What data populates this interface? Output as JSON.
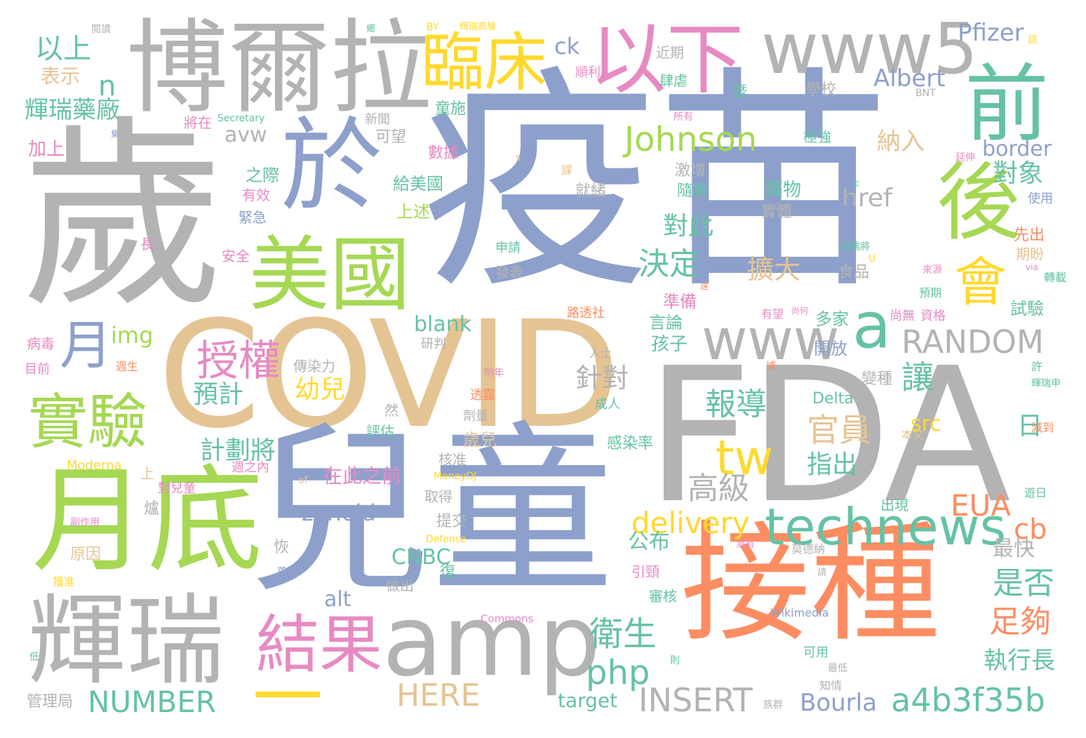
{
  "palette": {
    "grey": "#b3b3b3",
    "blue": "#8da0cb",
    "orange": "#fc8d62",
    "green": "#66c2a5",
    "pink": "#e78ac3",
    "lime": "#a6d854",
    "yellow": "#ffd92f",
    "tan": "#e5c494"
  },
  "words": [
    {
      "text": "疫苗",
      "color": "blue"
    },
    {
      "text": "歲",
      "color": "grey"
    },
    {
      "text": "FDA",
      "color": "grey"
    },
    {
      "text": "COVID",
      "color": "tan"
    },
    {
      "text": "兒童",
      "color": "blue"
    },
    {
      "text": "接種",
      "color": "orange"
    },
    {
      "text": "博爾拉",
      "color": "grey"
    },
    {
      "text": "月底",
      "color": "lime"
    },
    {
      "text": "輝瑞",
      "color": "grey"
    },
    {
      "text": "amp",
      "color": "grey"
    },
    {
      "text": "於",
      "color": "blue"
    },
    {
      "text": "美國",
      "color": "lime"
    },
    {
      "text": "以下",
      "color": "pink"
    },
    {
      "text": "www5",
      "color": "grey"
    },
    {
      "text": "前",
      "color": "green"
    },
    {
      "text": "後",
      "color": "lime"
    },
    {
      "text": "臨床",
      "color": "yellow"
    },
    {
      "text": "technews",
      "color": "green"
    },
    {
      "text": "結果",
      "color": "pink"
    },
    {
      "text": "實驗",
      "color": "lime"
    },
    {
      "text": "www",
      "color": "grey"
    },
    {
      "text": "a",
      "color": "green"
    },
    {
      "text": "會",
      "color": "yellow"
    },
    {
      "text": "月",
      "color": "blue"
    },
    {
      "text": "一",
      "color": "yellow"
    },
    {
      "text": "tw",
      "color": "yellow"
    },
    {
      "text": "Johnson",
      "color": "lime"
    },
    {
      "text": "授權",
      "color": "pink"
    },
    {
      "text": "a4b3f35b",
      "color": "green"
    },
    {
      "text": "RANDOM",
      "color": "grey"
    },
    {
      "text": "INSERT",
      "color": "grey"
    },
    {
      "text": "NUMBER",
      "color": "green"
    },
    {
      "text": "HERE",
      "color": "tan"
    },
    {
      "text": "delivery",
      "color": "yellow"
    },
    {
      "text": "php",
      "color": "green"
    },
    {
      "text": "Pfizer",
      "color": "blue"
    },
    {
      "text": "Albert",
      "color": "blue"
    },
    {
      "text": "Bourla",
      "color": "blue"
    },
    {
      "text": "以上",
      "color": "green"
    },
    {
      "text": "輝瑞藥廠",
      "color": "green"
    },
    {
      "text": "決定",
      "color": "green"
    },
    {
      "text": "報導",
      "color": "green"
    },
    {
      "text": "官員",
      "color": "tan"
    },
    {
      "text": "高級",
      "color": "grey"
    },
    {
      "text": "衛生",
      "color": "green"
    },
    {
      "text": "擴大",
      "color": "tan"
    },
    {
      "text": "是否",
      "color": "green"
    },
    {
      "text": "足夠",
      "color": "orange"
    },
    {
      "text": "EUA",
      "color": "orange"
    },
    {
      "text": "cb",
      "color": "orange"
    },
    {
      "text": "讓",
      "color": "green"
    },
    {
      "text": "對此",
      "color": "green"
    },
    {
      "text": "對象",
      "color": "green"
    },
    {
      "text": "href",
      "color": "grey"
    },
    {
      "text": "blank",
      "color": "green"
    },
    {
      "text": "zoneid",
      "color": "blue"
    },
    {
      "text": "alt",
      "color": "blue"
    },
    {
      "text": "src",
      "color": "yellow"
    },
    {
      "text": "img",
      "color": "lime"
    },
    {
      "text": "幼兒",
      "color": "yellow"
    },
    {
      "text": "針對",
      "color": "grey"
    },
    {
      "text": "預計",
      "color": "green"
    },
    {
      "text": "計劃將",
      "color": "green"
    },
    {
      "text": "指出",
      "color": "green"
    },
    {
      "text": "日",
      "color": "green"
    },
    {
      "text": "公布",
      "color": "green"
    },
    {
      "text": "最快",
      "color": "grey"
    },
    {
      "text": "執行長",
      "color": "green"
    },
    {
      "text": "CNBC",
      "color": "green"
    },
    {
      "text": "target",
      "color": "green"
    },
    {
      "text": "border",
      "color": "blue"
    },
    {
      "text": "納入",
      "color": "tan"
    },
    {
      "text": "ck",
      "color": "blue"
    },
    {
      "text": "n",
      "color": "green"
    },
    {
      "text": "avw",
      "color": "grey"
    },
    {
      "text": "表示",
      "color": "tan"
    },
    {
      "text": "加上",
      "color": "pink"
    },
    {
      "text": "在此之前",
      "color": "pink"
    },
    {
      "text": "藥物",
      "color": "green"
    },
    {
      "text": "實體",
      "color": "grey"
    },
    {
      "text": "食品",
      "color": "grey"
    },
    {
      "text": "孩子",
      "color": "green"
    },
    {
      "text": "開放",
      "color": "blue"
    },
    {
      "text": "多家",
      "color": "green"
    },
    {
      "text": "準備",
      "color": "pink"
    },
    {
      "text": "言論",
      "color": "green"
    },
    {
      "text": "試驗",
      "color": "green"
    },
    {
      "text": "歲兒",
      "color": "tan"
    },
    {
      "text": "感染率",
      "color": "green"
    },
    {
      "text": "Delta",
      "color": "green"
    },
    {
      "text": "變種",
      "color": "grey"
    },
    {
      "text": "隨著",
      "color": "green"
    },
    {
      "text": "激增",
      "color": "grey"
    },
    {
      "text": "就緒",
      "color": "grey"
    },
    {
      "text": "給美國",
      "color": "green"
    },
    {
      "text": "上述",
      "color": "lime"
    },
    {
      "text": "之際",
      "color": "green"
    },
    {
      "text": "可望",
      "color": "grey"
    },
    {
      "text": "數據",
      "color": "pink"
    },
    {
      "text": "童施",
      "color": "green"
    },
    {
      "text": "學校",
      "color": "grey"
    },
    {
      "text": "極強",
      "color": "green"
    },
    {
      "text": "先出",
      "color": "orange"
    },
    {
      "text": "期盼",
      "color": "tan"
    },
    {
      "text": "使用",
      "color": "blue"
    },
    {
      "text": "轉載",
      "color": "green"
    },
    {
      "text": "肆虐",
      "color": "green"
    },
    {
      "text": "暨",
      "color": "green"
    },
    {
      "text": "近期",
      "color": "grey"
    },
    {
      "text": "順利",
      "color": "pink"
    },
    {
      "text": "新聞",
      "color": "grey"
    },
    {
      "text": "將在",
      "color": "pink"
    },
    {
      "text": "有效",
      "color": "pink"
    },
    {
      "text": "緊急",
      "color": "blue"
    },
    {
      "text": "安全",
      "color": "pink"
    },
    {
      "text": "病毒",
      "color": "pink"
    },
    {
      "text": "目前",
      "color": "pink"
    },
    {
      "text": "長",
      "color": "pink"
    },
    {
      "text": "原因",
      "color": "tan"
    },
    {
      "text": "獲准",
      "color": "yellow"
    },
    {
      "text": "管理局",
      "color": "grey"
    },
    {
      "text": "副作用",
      "color": "pink"
    },
    {
      "text": "Moderna",
      "color": "yellow"
    },
    {
      "text": "對兒童",
      "color": "pink"
    },
    {
      "text": "週之內",
      "color": "pink"
    },
    {
      "text": "上",
      "color": "tan"
    },
    {
      "text": "爐",
      "color": "grey"
    },
    {
      "text": "提交",
      "color": "grey"
    },
    {
      "text": "恢",
      "color": "grey"
    },
    {
      "text": "復",
      "color": "green"
    },
    {
      "text": "出現",
      "color": "green"
    },
    {
      "text": "最低",
      "color": "grey"
    },
    {
      "text": "知情",
      "color": "grey"
    },
    {
      "text": "族群",
      "color": "grey"
    },
    {
      "text": "可用",
      "color": "green"
    },
    {
      "text": "Wikimedia",
      "color": "blue"
    },
    {
      "text": "Commons",
      "color": "pink"
    },
    {
      "text": "Defense",
      "color": "yellow"
    },
    {
      "text": "MoneyDJ",
      "color": "yellow"
    },
    {
      "text": "核准",
      "color": "grey"
    },
    {
      "text": "取得",
      "color": "grey"
    },
    {
      "text": "做出",
      "color": "grey"
    },
    {
      "text": "評估",
      "color": "green"
    },
    {
      "text": "劑量",
      "color": "grey"
    },
    {
      "text": "透露",
      "color": "orange"
    },
    {
      "text": "然",
      "color": "grey"
    },
    {
      "text": "成人",
      "color": "green"
    },
    {
      "text": "人士",
      "color": "grey"
    },
    {
      "text": "研判",
      "color": "grey"
    },
    {
      "text": "傳染力",
      "color": "grey"
    },
    {
      "text": "路透社",
      "color": "orange"
    },
    {
      "text": "發表",
      "color": "grey"
    },
    {
      "text": "申請",
      "color": "green"
    },
    {
      "text": "引頸",
      "color": "pink"
    },
    {
      "text": "審核",
      "color": "green"
    },
    {
      "text": "莫德納",
      "color": "grey"
    },
    {
      "text": "尚無",
      "color": "pink"
    },
    {
      "text": "資格",
      "color": "pink"
    },
    {
      "text": "有望",
      "color": "pink"
    },
    {
      "text": "預期",
      "color": "green"
    },
    {
      "text": "來源",
      "color": "pink"
    },
    {
      "text": "遊日",
      "color": "green"
    },
    {
      "text": "減到",
      "color": "orange"
    },
    {
      "text": "本文",
      "color": "tan"
    },
    {
      "text": "許",
      "color": "green"
    },
    {
      "text": "輝瑞申",
      "color": "green"
    },
    {
      "text": "輝瑞將",
      "color": "green"
    },
    {
      "text": "延伸",
      "color": "pink"
    },
    {
      "text": "BNT",
      "color": "grey"
    },
    {
      "text": "Secretary",
      "color": "green"
    },
    {
      "text": "閱讀",
      "color": "grey"
    },
    {
      "text": "BY",
      "color": "yellow"
    },
    {
      "text": "輝瑞高層",
      "color": "yellow"
    },
    {
      "text": "該",
      "color": "yellow"
    },
    {
      "text": "課",
      "color": "tan"
    },
    {
      "text": "所有",
      "color": "pink"
    },
    {
      "text": "首圖",
      "color": "blue"
    },
    {
      "text": "of",
      "color": "tan"
    },
    {
      "text": "明年",
      "color": "pink"
    },
    {
      "text": "週生",
      "color": "orange"
    },
    {
      "text": "據",
      "color": "orange"
    },
    {
      "text": "則",
      "color": "green"
    },
    {
      "text": "低",
      "color": "green"
    },
    {
      "text": "集",
      "color": "blue"
    },
    {
      "text": "將有",
      "color": "pink"
    },
    {
      "text": "請",
      "color": "grey"
    },
    {
      "text": "via",
      "color": "pink"
    },
    {
      "text": "尚何",
      "color": "pink"
    },
    {
      "text": "cc",
      "color": "green"
    },
    {
      "text": "s",
      "color": "tan"
    },
    {
      "text": "遠",
      "color": "orange"
    },
    {
      "text": "U",
      "color": "yellow"
    },
    {
      "text": "鄉",
      "color": "green"
    }
  ]
}
